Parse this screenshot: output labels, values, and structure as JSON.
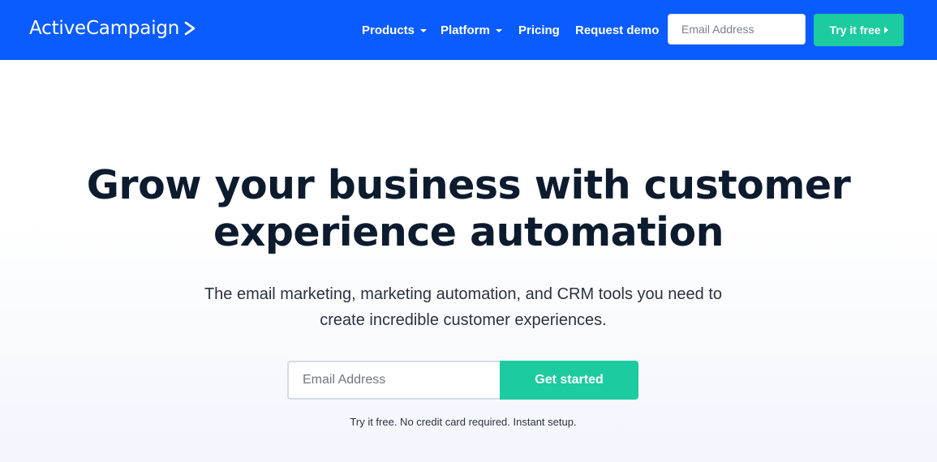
{
  "header": {
    "logo_text": "ActiveCampaign",
    "nav": [
      {
        "label": "Products",
        "has_dropdown": true
      },
      {
        "label": "Platform",
        "has_dropdown": true
      },
      {
        "label": "Pricing",
        "has_dropdown": false
      },
      {
        "label": "Request demo",
        "has_dropdown": false
      }
    ],
    "email_placeholder": "Email Address",
    "cta_label": "Try it free"
  },
  "hero": {
    "headline_line1": "Grow your business with customer",
    "headline_line2": "experience automation",
    "subtext_line1": "The email marketing, marketing automation, and CRM tools you need to",
    "subtext_line2": "create incredible customer experiences.",
    "email_placeholder": "Email Address",
    "cta_label": "Get started",
    "note": "Try it free. No credit card required. Instant setup."
  },
  "colors": {
    "brand_blue": "#0b5cff",
    "accent_green": "#1ccb9f",
    "headline": "#0d1b2e"
  }
}
